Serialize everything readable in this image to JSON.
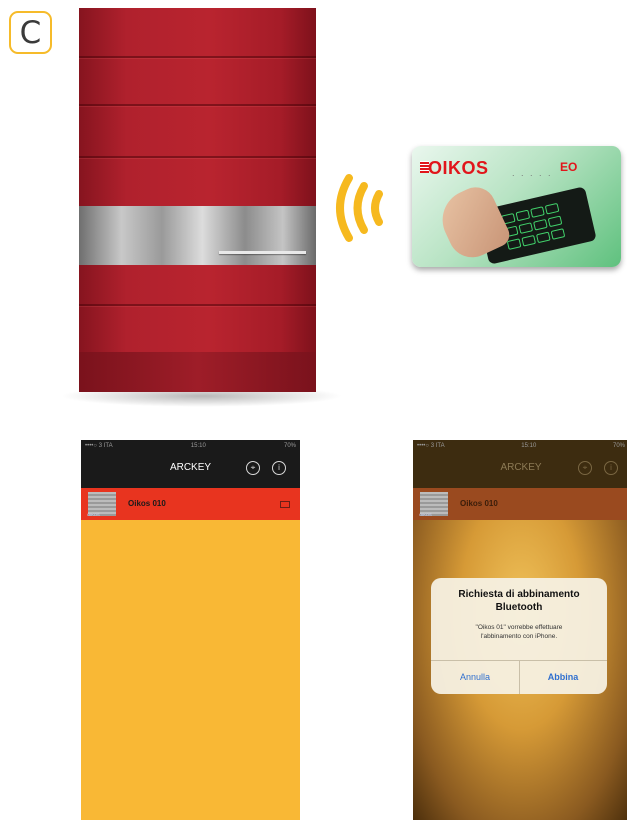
{
  "badge": {
    "letter": "C"
  },
  "card": {
    "brand": "OIKOS",
    "dots": ". . . . .",
    "right_mark": "EO"
  },
  "phone_left": {
    "status": {
      "carrier": "••••○ 3 ITA",
      "time": "15:10",
      "battery": "70%"
    },
    "nav": {
      "title": "ARCKEY",
      "icon1": "⌖",
      "icon2": "i"
    },
    "device": {
      "name": "Oikos 010",
      "thumb_label": "OIKOS"
    }
  },
  "phone_right": {
    "status": {
      "carrier": "••••○ 3 ITA",
      "time": "15:10",
      "battery": "70%"
    },
    "nav": {
      "title": "ARCKEY",
      "icon1": "⌖",
      "icon2": "i"
    },
    "device": {
      "name": "Oikos 010",
      "thumb_label": "OIKOS"
    },
    "alert": {
      "title_line1": "Richiesta di abbinamento",
      "title_line2": "Bluetooth",
      "message_line1": "\"Oikos 01\" vorrebbe effettuare",
      "message_line2": "l'abbinamento con iPhone.",
      "cancel_label": "Annulla",
      "confirm_label": "Abbina"
    }
  }
}
